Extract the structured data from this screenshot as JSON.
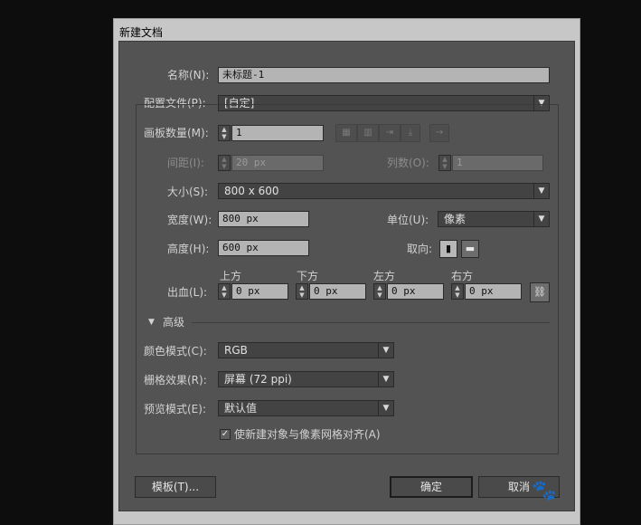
{
  "window": {
    "title": "新建文档"
  },
  "name": {
    "label": "名称(N):",
    "value": "未标题-1"
  },
  "profile": {
    "label": "配置文件(P):",
    "value": "[自定]"
  },
  "artboards": {
    "count_label": "画板数量(M):",
    "count_value": "1",
    "spacing_label": "间距(I):",
    "spacing_value": "20 px",
    "columns_label": "列数(O):",
    "columns_value": "1"
  },
  "size": {
    "label": "大小(S):",
    "value": "800 x 600"
  },
  "width": {
    "label": "宽度(W):",
    "value": "800 px"
  },
  "units": {
    "label": "单位(U):",
    "value": "像素"
  },
  "height": {
    "label": "高度(H):",
    "value": "600 px"
  },
  "orientation": {
    "label": "取向:"
  },
  "bleed": {
    "label": "出血(L):",
    "top_label": "上方",
    "top_value": "0 px",
    "bottom_label": "下方",
    "bottom_value": "0 px",
    "left_label": "左方",
    "left_value": "0 px",
    "right_label": "右方",
    "right_value": "0 px"
  },
  "advanced": {
    "label": "高级",
    "color_mode_label": "颜色模式(C):",
    "color_mode_value": "RGB",
    "raster_label": "栅格效果(R):",
    "raster_value": "屏幕 (72 ppi)",
    "preview_label": "预览模式(E):",
    "preview_value": "默认值",
    "align_label": "使新建对象与像素网格对齐(A)",
    "align_checked": true
  },
  "buttons": {
    "templates": "模板(T)...",
    "ok": "确定",
    "cancel": "取消"
  }
}
